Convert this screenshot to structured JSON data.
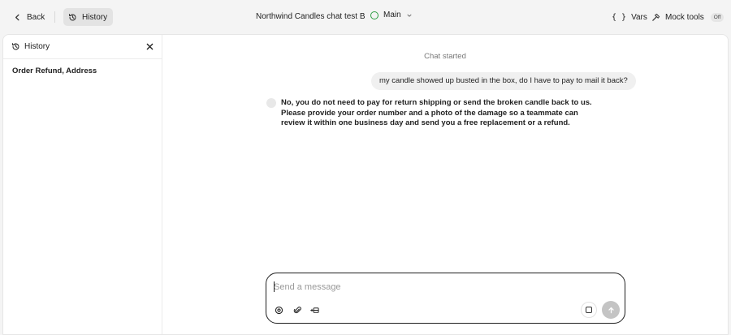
{
  "topbar": {
    "back_label": "Back",
    "history_label": "History",
    "title": "Northwind Candles chat test B",
    "branch_label": "Main",
    "vars_label": "Vars",
    "vars_braces": "{ }",
    "mock_tools_label": "Mock tools",
    "mock_tools_state": "Off"
  },
  "sidebar": {
    "title": "History",
    "items": [
      {
        "label": "Order Refund, Address"
      }
    ]
  },
  "chat": {
    "started_label": "Chat started",
    "messages": [
      {
        "role": "user",
        "text": "my candle showed up busted in the box, do I have to pay to mail it back?"
      },
      {
        "role": "assistant",
        "text": "No, you do not need to pay for return shipping or send the broken candle back to us. Please provide your order number and a photo of the damage so a teammate can review it within one business day and send you a free replacement or a refund."
      }
    ]
  },
  "composer": {
    "placeholder": "Send a message",
    "value": ""
  },
  "colors": {
    "branch_status": "#2f9e44",
    "composer_border": "#1f1f1f",
    "send_button": "#c4c4c4"
  }
}
